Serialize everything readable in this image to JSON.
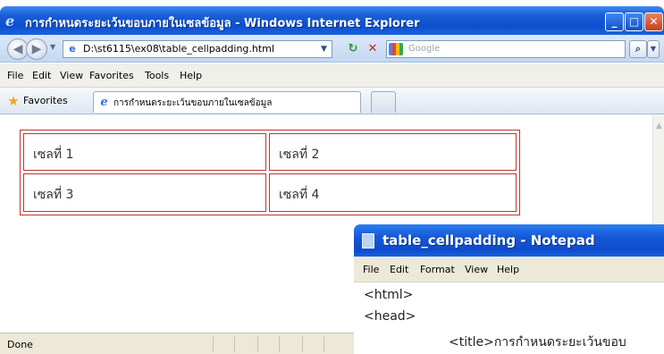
{
  "ie": {
    "title": "การกำหนดระยะเว้นขอบภายในเซลข้อมูล - Windows Internet Explorer",
    "icon": "ie-logo-icon",
    "window_buttons": {
      "minimize": "_",
      "maximize": "□",
      "close": "✕"
    },
    "nav": {
      "back_icon": "◀",
      "forward_icon": "▶"
    },
    "address": "D:\\st6115\\ex08\\table_cellpadding.html",
    "search": {
      "placeholder": "Google",
      "go_icon": "⌕"
    },
    "menu": [
      "File",
      "Edit",
      "View",
      "Favorites",
      "Tools",
      "Help"
    ],
    "favorites_label": "Favorites",
    "tab_label": "การกำหนดระยะเว้นขอบภายในเซลข้อมูล",
    "table": {
      "cells": [
        [
          "เซลที่ 1",
          "เซลที่ 2"
        ],
        [
          "เซลที่ 3",
          "เซลที่ 4"
        ]
      ],
      "border_color": "#c4322c"
    },
    "status": "Done"
  },
  "notepad": {
    "title": "table_cellpadding - Notepad",
    "menu": [
      "File",
      "Edit",
      "Format",
      "View",
      "Help"
    ],
    "lines": [
      "<html>",
      "<head>",
      "<title>การกำหนดระยะเว้นขอบ"
    ]
  },
  "colors": {
    "titlebar": "#0c4fcf",
    "menubar": "#ece9d8",
    "table_border": "#c4322c"
  }
}
